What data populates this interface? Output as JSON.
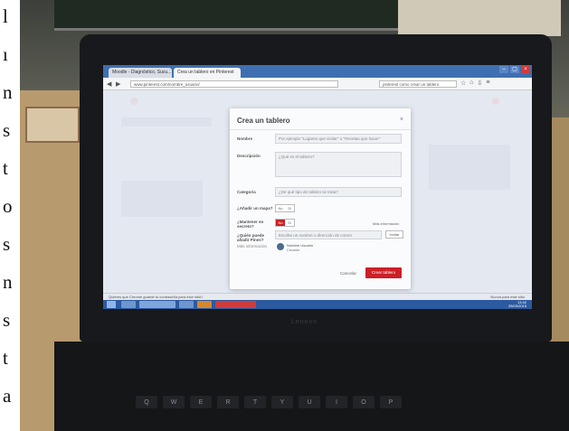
{
  "side_text": [
    "l",
    "ı",
    "n",
    "s",
    "t",
    "o",
    "s",
    "n",
    "s",
    "t",
    "a"
  ],
  "laptop": {
    "brand": "Lenovo"
  },
  "browser": {
    "tabs": [
      {
        "label": "Moodle - Diagnóstico, Sucu..."
      },
      {
        "label": "Crea un tablero en Pinterest"
      }
    ],
    "address": "www.pinterest.com/nombre_usuario/",
    "search_placeholder": "pinterest como crear un tablero",
    "window_buttons": [
      "–",
      "▢",
      "×"
    ]
  },
  "modal": {
    "title": "Crea un tablero",
    "close": "×",
    "name_label": "Nombre",
    "name_placeholder": "Por ejemplo \"Lugares que visitar\" o \"Recetas que hacer\"",
    "description_label": "Descripción",
    "description_placeholder": "¿Qué es el tablero?",
    "category_label": "Categoría",
    "category_value": "¿De qué tipo de tablero se trata?",
    "map_label": "¿Añadir un mapa?",
    "map_toggle": {
      "no": "No",
      "yes": "Sí"
    },
    "secret_label": "¿Mantener en secreto?",
    "secret_toggle": {
      "no": "No",
      "yes": "Sí"
    },
    "more_info": "Más información",
    "collab_label": "¿Quién puede añadir Pines?",
    "collab_more": "Más información",
    "collab_placeholder": "Escribe un nombre o dirección de correo",
    "invite_button": "Invitar",
    "collab_name": "Nombre Usuario",
    "collab_role": "Creador",
    "cancel_button": "Cancelar",
    "create_button": "Crear tablero"
  },
  "infobar": {
    "message": "Quieres que Chrome guarde tu contraseña para este sitio?",
    "right": "Nunca para este sitio"
  },
  "taskbar": {
    "time": "13:42",
    "date": "25/03/2015"
  },
  "keyboard_keys": [
    "Q",
    "W",
    "E",
    "R",
    "T",
    "Y",
    "U",
    "I",
    "O",
    "P"
  ],
  "colors": {
    "accent": "#cb2027",
    "taskbar": "#2c5aa0"
  }
}
